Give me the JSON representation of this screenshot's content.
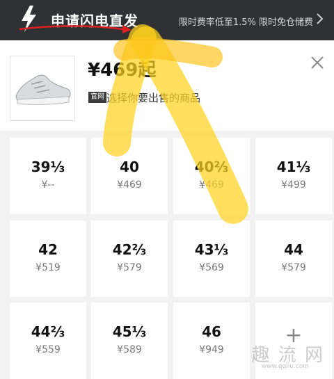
{
  "banner": {
    "title": "申请闪电直发",
    "promo": "限时费率低至1.5% 限时免仓储费",
    "colors": {
      "background": "#2f3134",
      "annotation_arrow": "#e02020"
    }
  },
  "product": {
    "price": "¥469起",
    "tag": "官网",
    "hint": "选择你要出售的商品"
  },
  "sizes": [
    {
      "size": "39⅓",
      "price": "¥--"
    },
    {
      "size": "40",
      "price": "¥469"
    },
    {
      "size": "40⅔",
      "price": "¥469"
    },
    {
      "size": "41⅓",
      "price": "¥499"
    },
    {
      "size": "42",
      "price": "¥519"
    },
    {
      "size": "42⅔",
      "price": "¥579"
    },
    {
      "size": "43⅓",
      "price": "¥569"
    },
    {
      "size": "44",
      "price": "¥579"
    },
    {
      "size": "44⅔",
      "price": "¥559"
    },
    {
      "size": "45⅓",
      "price": "¥589"
    },
    {
      "size": "46",
      "price": "¥949"
    }
  ],
  "add_cell": {
    "label": "+"
  },
  "watermark": {
    "text": "趣 流 网",
    "url": "www.qqliu.com"
  },
  "overlay_color": "#ffd21f"
}
